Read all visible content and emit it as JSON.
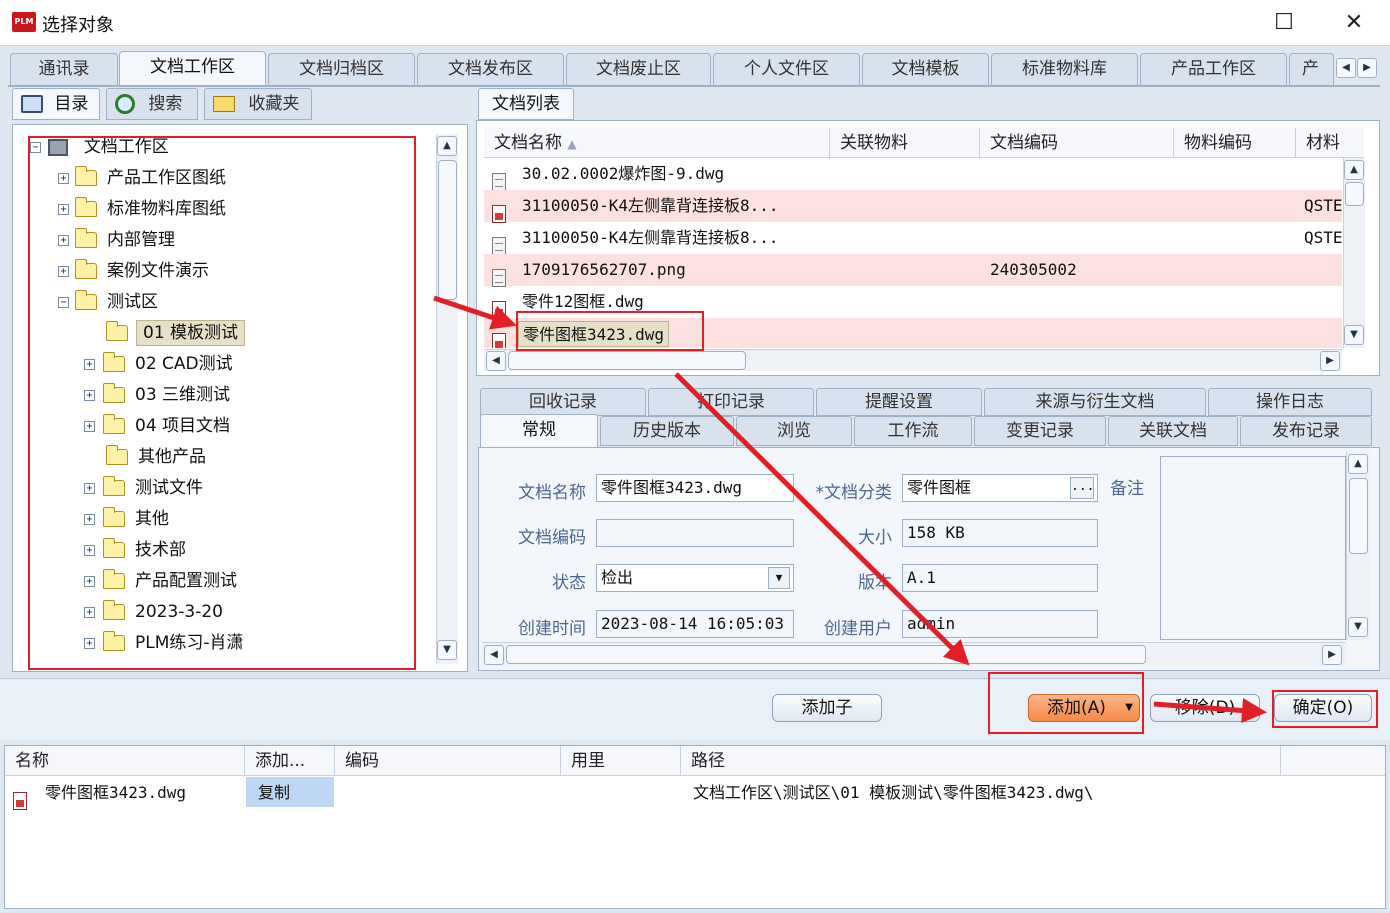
{
  "window": {
    "logo_text": "PLM",
    "title": "选择对象",
    "maximize_glyph": "☐",
    "close_glyph": "✕"
  },
  "main_tabs": [
    "通讯录",
    "文档工作区",
    "文档归档区",
    "文档发布区",
    "文档废止区",
    "个人文件区",
    "文档模板",
    "标准物料库",
    "产品工作区",
    "产"
  ],
  "left_tabs": {
    "catalog": "目录",
    "search": "搜索",
    "favorites": "收藏夹"
  },
  "tree": {
    "root": "文档工作区",
    "nodes": [
      "产品工作区图纸",
      "标准物料库图纸",
      "内部管理",
      "案例文件演示",
      "测试区"
    ],
    "children": [
      "01 模板测试",
      "02 CAD测试",
      "03 三维测试",
      "04 项目文档",
      "其他产品",
      "测试文件",
      "其他",
      "技术部",
      "产品配置测试",
      "2023-3-20",
      "PLM练习-肖潇"
    ],
    "expander_plus": "+",
    "expander_minus": "−"
  },
  "doc_list": {
    "tab": "文档列表",
    "columns": [
      "文档名称",
      "关联物料",
      "文档编码",
      "物料编码",
      "材料"
    ],
    "rows": [
      {
        "name": "30.02.0002爆炸图-9.dwg",
        "code": "",
        "material": ""
      },
      {
        "name": "31100050-K4左侧靠背连接板8...",
        "code": "",
        "material": "QSTE"
      },
      {
        "name": "31100050-K4左侧靠背连接板8...",
        "code": "",
        "material": "QSTE"
      },
      {
        "name": "1709176562707.png",
        "code": "240305002",
        "material": ""
      },
      {
        "name": "零件12图框.dwg",
        "code": "",
        "material": ""
      },
      {
        "name": "零件图框3423.dwg",
        "code": "",
        "material": ""
      }
    ]
  },
  "detail_tabs_top": [
    "回收记录",
    "打印记录",
    "提醒设置",
    "来源与衍生文档",
    "操作日志"
  ],
  "detail_tabs_bottom": [
    "常规",
    "历史版本",
    "浏览",
    "工作流",
    "变更记录",
    "关联文档",
    "发布记录"
  ],
  "form": {
    "doc_name_label": "文档名称",
    "doc_name": "零件图框3423.dwg",
    "category_label": "*文档分类",
    "category": "零件图框",
    "ellipsis": "...",
    "remark_label": "备注",
    "doc_code_label": "文档编码",
    "doc_code": "",
    "size_label": "大小",
    "size": "158 KB",
    "status_label": "状态",
    "status": "检出",
    "version_label": "版本",
    "version": "A.1",
    "created_label": "创建时间",
    "created": "2023-08-14 16:05:03",
    "creator_label": "创建用户",
    "creator": "admin"
  },
  "buttons": {
    "add_child": "添加子",
    "add": "添加(A)",
    "remove": "移除(D)",
    "ok": "确定(O)"
  },
  "selected": {
    "columns": [
      "名称",
      "添加...",
      "编码",
      "用里",
      "路径"
    ],
    "rows": [
      {
        "name": "零件图框3423.dwg",
        "add_mode": "复制",
        "code": "",
        "qty": "",
        "path": "文档工作区\\测试区\\01 模板测试\\零件图框3423.dwg\\"
      }
    ]
  },
  "colors": {
    "highlight_red": "#e21e26",
    "row_pink": "#fde0e0",
    "add_button": "#f79a5a"
  }
}
